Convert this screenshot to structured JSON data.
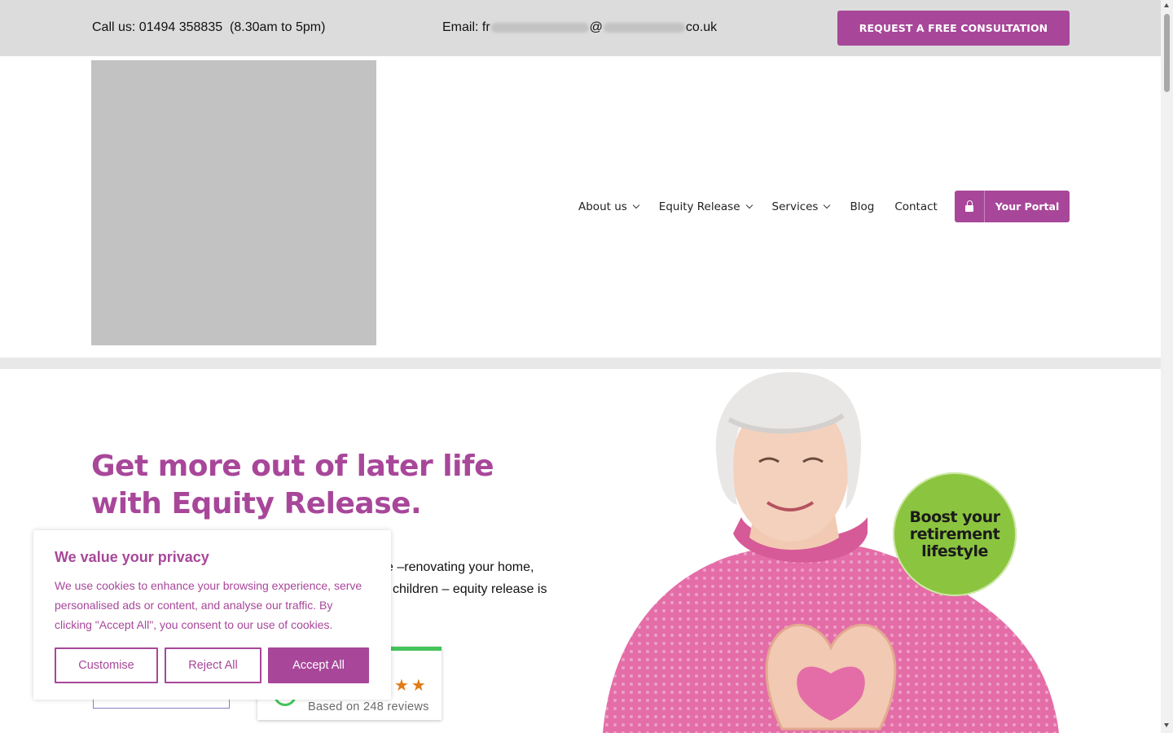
{
  "topbar": {
    "call_text": "Call us: 01494 358835  (8.30am to 5pm)",
    "email_prefix": "Email: fr",
    "email_at": "@",
    "email_suffix": "co.uk",
    "cta_label": "REQUEST A FREE CONSULTATION"
  },
  "nav": {
    "items": [
      {
        "label": "About us",
        "dropdown": true
      },
      {
        "label": "Equity Release",
        "dropdown": true
      },
      {
        "label": "Services",
        "dropdown": true
      },
      {
        "label": "Blog",
        "dropdown": false
      },
      {
        "label": "Contact",
        "dropdown": false
      }
    ],
    "portal_label": "Your Portal",
    "portal_icon": "lock-icon"
  },
  "hero": {
    "title": "Get more out of later life with Equity Release.",
    "body_line1": "e –renovating your home,",
    "body_line2": "children – equity release is",
    "badge_text": "Boost your retirement lifestyle"
  },
  "reviews": {
    "stars": "★★",
    "based_on": "Based on 248 reviews"
  },
  "cookie": {
    "title": "We value your privacy",
    "text": "We use cookies to enhance your browsing experience, serve personalised ads or content, and analyse our traffic. By clicking \"Accept All\", you consent to our use of cookies.",
    "customise_label": "Customise",
    "reject_label": "Reject All",
    "accept_label": "Accept All"
  },
  "colors": {
    "brand": "#a8479a",
    "badge_green": "#8bc53f",
    "review_green": "#44c45a",
    "star_orange": "#e07b17",
    "topbar_bg": "#dcdcdc"
  }
}
